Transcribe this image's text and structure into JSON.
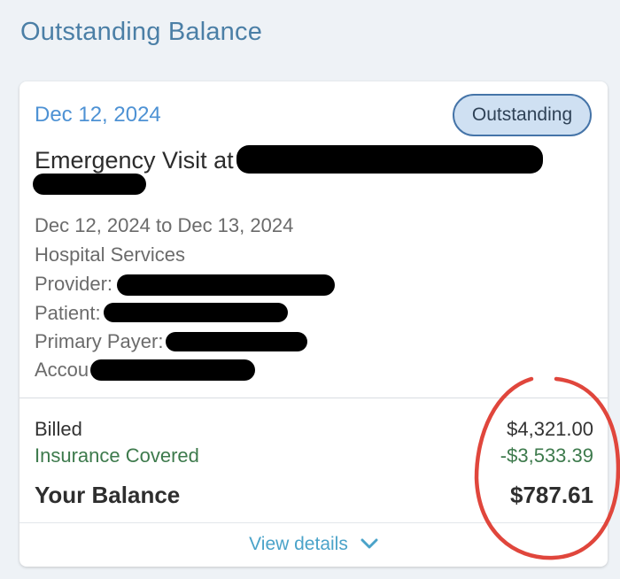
{
  "page": {
    "title": "Outstanding Balance"
  },
  "bill": {
    "date": "Dec 12, 2024",
    "status": "Outstanding",
    "title_prefix": "Emergency Visit at",
    "date_range": "Dec 12, 2024 to Dec 13, 2024",
    "service_type": "Hospital Services",
    "provider_label": "Provider:",
    "patient_label": "Patient:",
    "payer_label": "Primary Payer:",
    "account_label": "Accou"
  },
  "summary": {
    "billed_label": "Billed",
    "billed_value": "$4,321.00",
    "covered_label": "Insurance Covered",
    "covered_value": "-$3,533.39",
    "balance_label": "Your Balance",
    "balance_value": "$787.61"
  },
  "actions": {
    "view_details": "View details"
  },
  "colors": {
    "accent": "#4e92d4",
    "covered_green": "#3d7a4c",
    "link": "#4aa3c9",
    "annotation_red": "#e0463c"
  }
}
